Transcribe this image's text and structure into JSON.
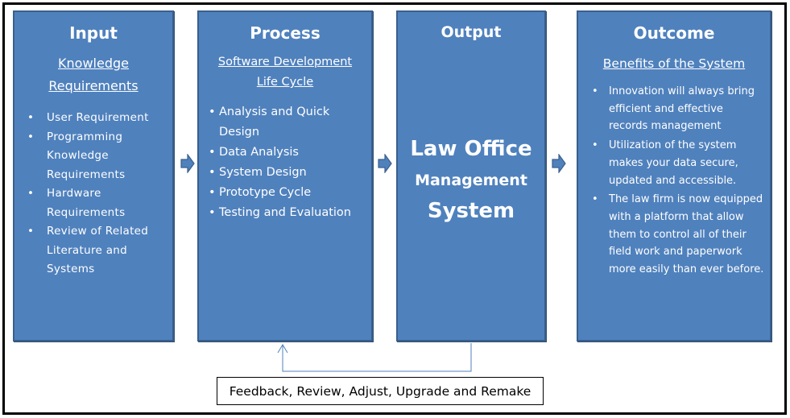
{
  "colors": {
    "box_fill": "#4f81bd",
    "box_border": "#3a5f8b",
    "arrow_fill": "#4f81bd",
    "connector": "#4f81bd",
    "text": "#ffffff"
  },
  "input": {
    "title": "Input",
    "subtitle_line1": "Knowledge",
    "subtitle_line2": "Requirements",
    "items": [
      "User Requirement",
      "Programming Knowledge Requirements",
      "Hardware Requirements",
      "Review of Related Literature and Systems"
    ]
  },
  "process": {
    "title": "Process",
    "subtitle_line1": "Software Development",
    "subtitle_line2": "Life Cycle",
    "items": [
      "Analysis and Quick Design",
      "Data Analysis",
      "System Design",
      "Prototype Cycle",
      "Testing and Evaluation"
    ]
  },
  "output": {
    "title": "Output",
    "system_line1": "Law Office",
    "system_line2": "Management",
    "system_line3": "System"
  },
  "outcome": {
    "title": "Outcome",
    "subtitle": "Benefits of the System",
    "items": [
      "Innovation will always bring efficient and effective records management",
      "Utilization of the system makes your data secure, updated and accessible.",
      "The law firm is now equipped with a platform that allow them to control all of their field work and paperwork more easily than ever before."
    ]
  },
  "arrows": [
    "arrow-right-icon",
    "arrow-right-icon",
    "arrow-right-icon"
  ],
  "feedback": {
    "label": "Feedback, Review, Adjust, Upgrade and Remake"
  }
}
